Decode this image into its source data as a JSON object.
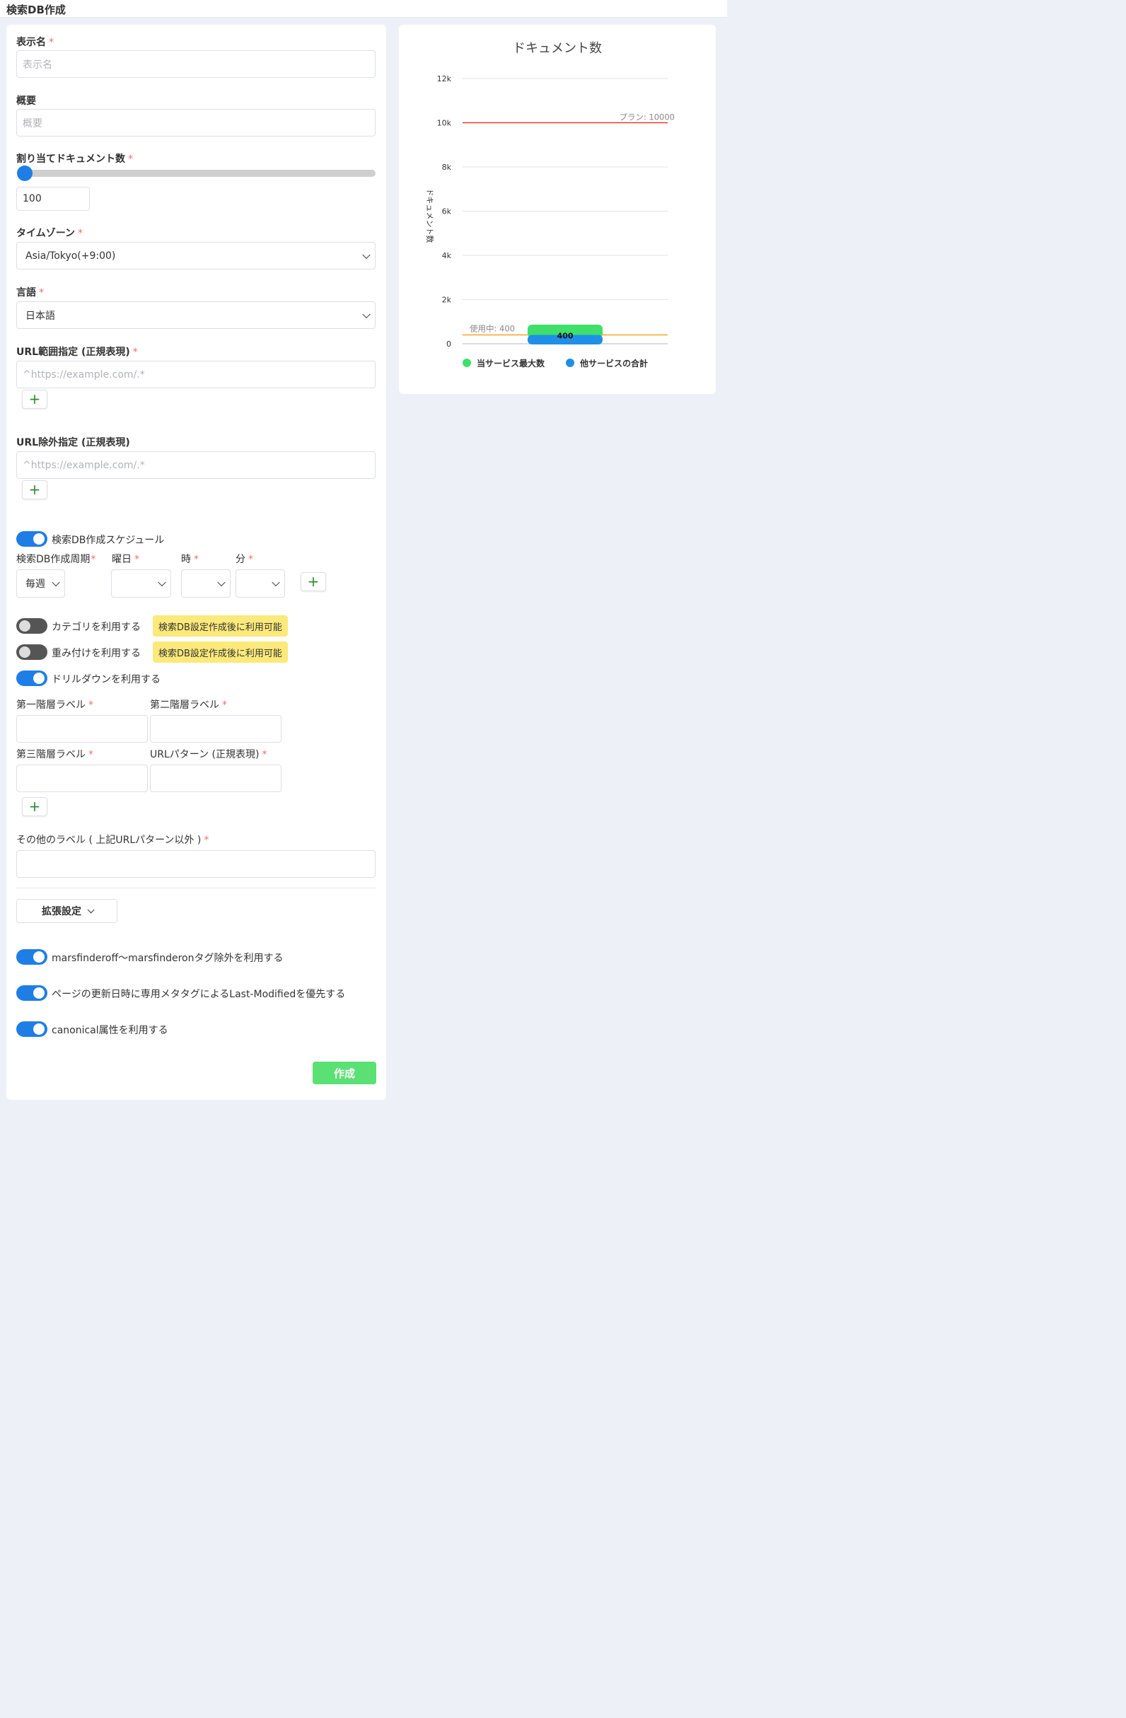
{
  "header": {
    "title": "検索DB作成"
  },
  "form": {
    "display_name": {
      "label": "表示名",
      "placeholder": "表示名"
    },
    "summary": {
      "label": "概要",
      "placeholder": "概要"
    },
    "doc_alloc": {
      "label": "割り当てドキュメント数",
      "value": "100",
      "slider_fraction": 0.0
    },
    "timezone": {
      "label": "タイムゾーン",
      "value": "Asia/Tokyo(+9:00)"
    },
    "language": {
      "label": "言語",
      "value": "日本語"
    },
    "url_range": {
      "label": "URL範囲指定 (正規表現)",
      "placeholder": "^https://example.com/.*"
    },
    "url_exclude": {
      "label": "URL除外指定 (正規表現)",
      "placeholder": "^https://example.com/.*"
    },
    "plus_symbol": "+",
    "schedule": {
      "toggle_label": "検索DB作成スケジュール",
      "toggle_on": true,
      "period_label": "検索DB作成周期",
      "period_value": "毎週",
      "weekday_label": "曜日",
      "hour_label": "時",
      "minute_label": "分"
    },
    "category": {
      "label": "カテゴリを利用する",
      "badge": "検索DB設定作成後に利用可能",
      "toggle_on": false
    },
    "weighting": {
      "label": "重み付けを利用する",
      "badge": "検索DB設定作成後に利用可能",
      "toggle_on": false
    },
    "drilldown": {
      "label": "ドリルダウンを利用する",
      "toggle_on": true,
      "level1_label": "第一階層ラベル",
      "level2_label": "第二階層ラベル",
      "level3_label": "第三階層ラベル",
      "url_pattern_label": "URLパターン (正規表現)",
      "other_label": "その他のラベル ( 上記URLパターン以外 )"
    },
    "extended_settings": "拡張設定",
    "options": [
      {
        "label": "marsfinderoff〜marsfinderonタグ除外を利用する",
        "on": true
      },
      {
        "label": "ページの更新日時に専用メタタグによるLast-Modifiedを優先する",
        "on": true
      },
      {
        "label": "canonical属性を利用する",
        "on": true
      }
    ],
    "submit": "作成"
  },
  "colors": {
    "accent": "#1f7ee6",
    "required": "#f56c6c",
    "create_button": "#5ae073",
    "badge": "#fbe97a"
  },
  "chart_data": {
    "type": "bar",
    "title": "ドキュメント数",
    "ylabel": "ドキュメント数",
    "xlabel": "",
    "ylim": [
      0,
      12000
    ],
    "yticks": [
      0,
      2000,
      4000,
      6000,
      8000,
      10000,
      12000
    ],
    "ytick_labels": [
      "0",
      "2k",
      "4k",
      "6k",
      "8k",
      "10k",
      "12k"
    ],
    "series": [
      {
        "name": "当サービス最大数",
        "values": [
          400
        ],
        "color": "#3ee06a"
      },
      {
        "name": "他サービスの合計",
        "values": [
          400
        ],
        "color": "#1f8fe8"
      }
    ],
    "bar_label": "400",
    "reference_lines": [
      {
        "label": "プラン: 10000",
        "value": 10000,
        "color": "#e53935"
      },
      {
        "label": "使用中: 400",
        "value": 400,
        "color": "#f5a623"
      }
    ],
    "grid": true,
    "legend_position": "bottom"
  }
}
